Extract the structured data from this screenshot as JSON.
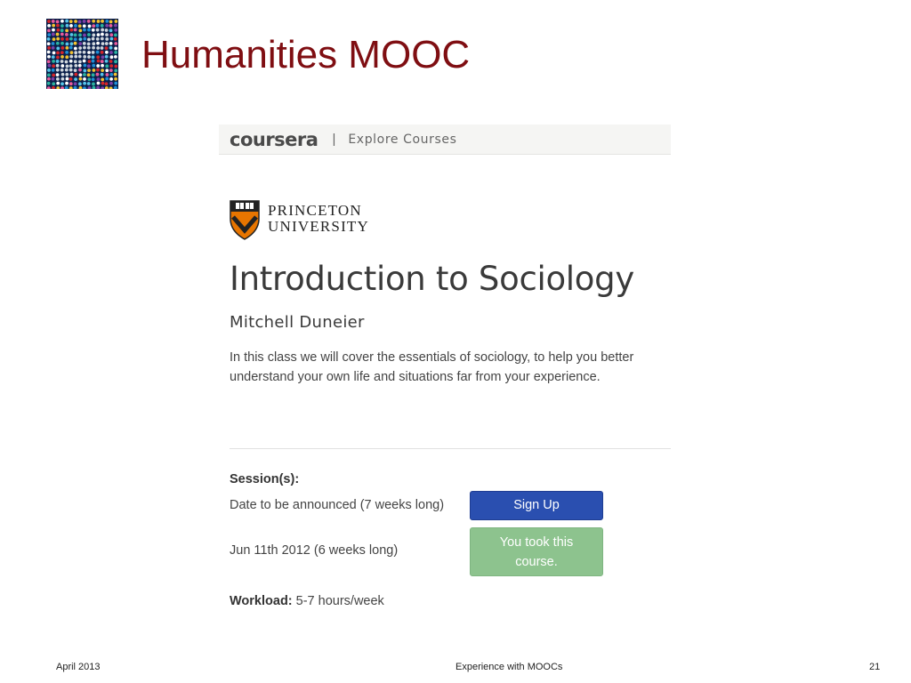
{
  "slide": {
    "title": "Humanities MOOC",
    "footer_left": "April 2013",
    "footer_center": "Experience with MOOCs",
    "footer_right": "21"
  },
  "coursera": {
    "brand": "coursera",
    "separator": "|",
    "nav_link": "Explore Courses",
    "university_line1": "PRINCETON",
    "university_line2": "UNIVERSITY",
    "course_title": "Introduction to Sociology",
    "instructor": "Mitchell Duneier",
    "description_line1": "In this class we will cover the essentials of sociology, to help you better",
    "description_line2": "understand your own life and situations far from your experience.",
    "sessions_label": "Session(s):",
    "session1": "Date to be announced (7 weeks long)",
    "session2": "Jun 11th 2012 (6 weeks long)",
    "signup_label": "Sign Up",
    "took_label": "You took this course.",
    "workload_label": "Workload:",
    "workload_value": " 5-7 hours/week"
  },
  "colors": {
    "title": "#7f0e12",
    "signup_button": "#2a4fb0",
    "took_button": "#8dc38e",
    "princeton_orange": "#e77500"
  },
  "icons": {
    "slide_logo": "dotted-dolphin-artwork",
    "university_logo": "princeton-shield-icon"
  }
}
